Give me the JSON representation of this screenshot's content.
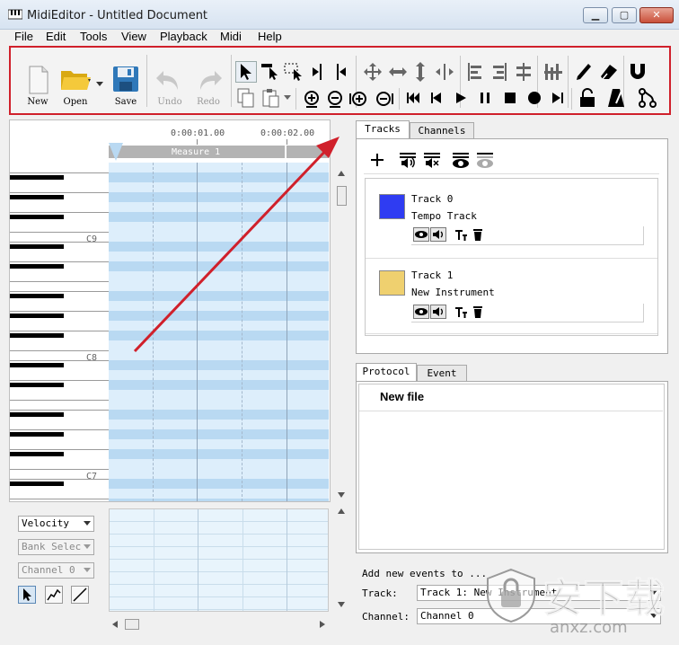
{
  "window": {
    "title": "MidiEditor - Untitled Document",
    "min": "▁",
    "max": "▢",
    "close": "✕"
  },
  "menu": [
    "File",
    "Edit",
    "Tools",
    "View",
    "Playback",
    "Midi",
    "Help"
  ],
  "toolbar": {
    "new_label": "New",
    "open_label": "Open",
    "save_label": "Save",
    "undo_label": "Undo",
    "redo_label": "Redo"
  },
  "ruler": {
    "time1": "0:00:01.00",
    "time2": "0:00:02.00",
    "measure": "Measure 1"
  },
  "piano": {
    "octaves": [
      "C9",
      "C8",
      "C7"
    ]
  },
  "bottom_left": {
    "velocity": "Velocity",
    "bank": "Bank Selec",
    "channel": "Channel 0"
  },
  "tabs_top": {
    "tracks": "Tracks",
    "channels": "Channels"
  },
  "tracks": [
    {
      "name": "Track 0",
      "instrument": "Tempo Track",
      "color": "#2f3cf2"
    },
    {
      "name": "Track 1",
      "instrument": "New Instrument",
      "color": "#efd06f"
    }
  ],
  "tabs_bottom": {
    "protocol": "Protocol",
    "event": "Event"
  },
  "protocol": {
    "entry": "New file"
  },
  "add_events": {
    "heading": "Add new events to ...",
    "track_label": "Track:",
    "track_value": "Track 1: New Instrument",
    "channel_label": "Channel:",
    "channel_value": "Channel 0"
  },
  "watermark": {
    "text": "安下载",
    "site": "anxz.com"
  },
  "colors": {
    "annotation": "#d0202b",
    "grid_light": "#ddeefb",
    "grid_dark": "#b9d9f2"
  }
}
